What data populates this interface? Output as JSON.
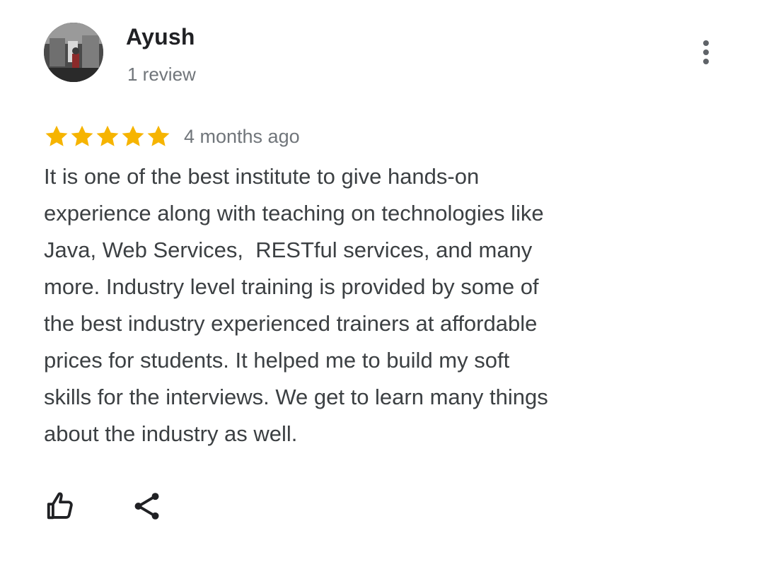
{
  "review": {
    "author": {
      "name": "Ayush",
      "meta": "1 review",
      "avatar_icon": "user-photo-avatar"
    },
    "rating": 5,
    "rating_max": 5,
    "star_color": "#f6b400",
    "date": "4 months ago",
    "text": "It is one of the best institute to give hands-on\nexperience along with teaching on technologies like\nJava, Web Services,  RESTful services, and many\nmore. Industry level training is provided by some of\nthe best industry experienced trainers at affordable\nprices for students. It helped me to build my soft\nskills for the interviews. We get to learn many things\nabout the industry as well.",
    "menu_icon": "more-vert-icon",
    "actions": [
      {
        "name": "like",
        "icon": "thumb-up-icon"
      },
      {
        "name": "share",
        "icon": "share-icon"
      }
    ]
  }
}
